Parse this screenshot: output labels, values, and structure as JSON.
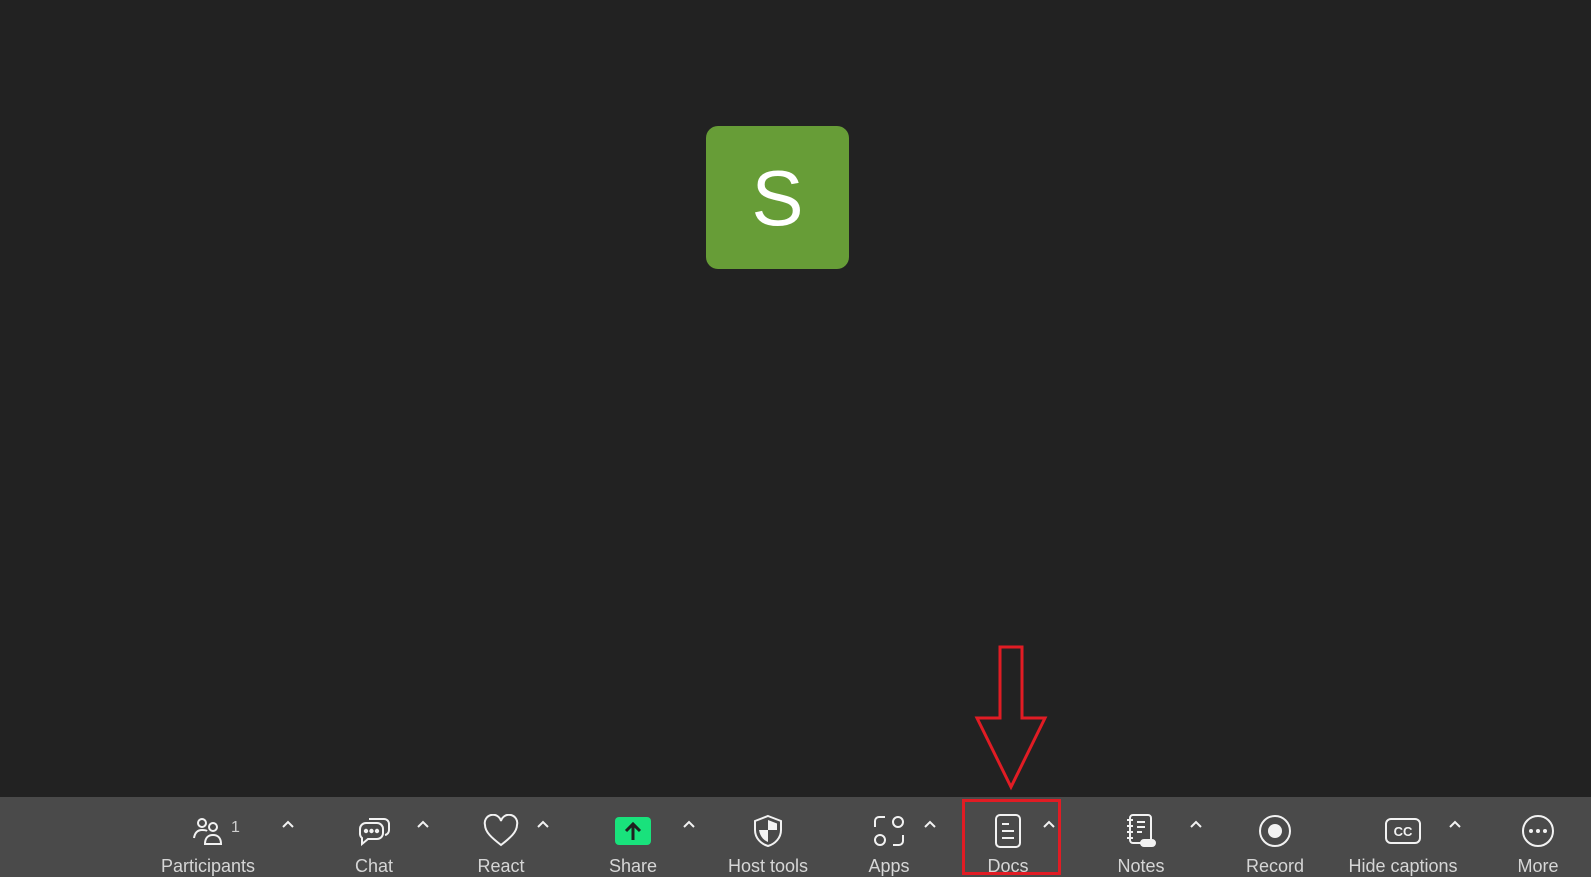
{
  "participant": {
    "initial": "S",
    "avatar_color": "#679d37"
  },
  "toolbar": {
    "participants": {
      "label": "Participants",
      "count": "1",
      "icon": "participants-icon"
    },
    "chat": {
      "label": "Chat",
      "icon": "chat-bubble-icon"
    },
    "react": {
      "label": "React",
      "icon": "heart-icon"
    },
    "share": {
      "label": "Share",
      "icon": "share-arrow-icon",
      "accent": "#19e27c"
    },
    "host_tools": {
      "label": "Host tools",
      "icon": "shield-icon"
    },
    "apps": {
      "label": "Apps",
      "icon": "apps-icon"
    },
    "docs": {
      "label": "Docs",
      "icon": "document-icon"
    },
    "notes": {
      "label": "Notes",
      "icon": "notebook-icon"
    },
    "record": {
      "label": "Record",
      "icon": "record-icon"
    },
    "captions": {
      "label": "Hide captions",
      "icon": "cc-icon"
    },
    "more": {
      "label": "More",
      "icon": "more-dots-icon"
    }
  },
  "annotation": {
    "highlight_color": "#e11c24",
    "target": "Docs"
  }
}
